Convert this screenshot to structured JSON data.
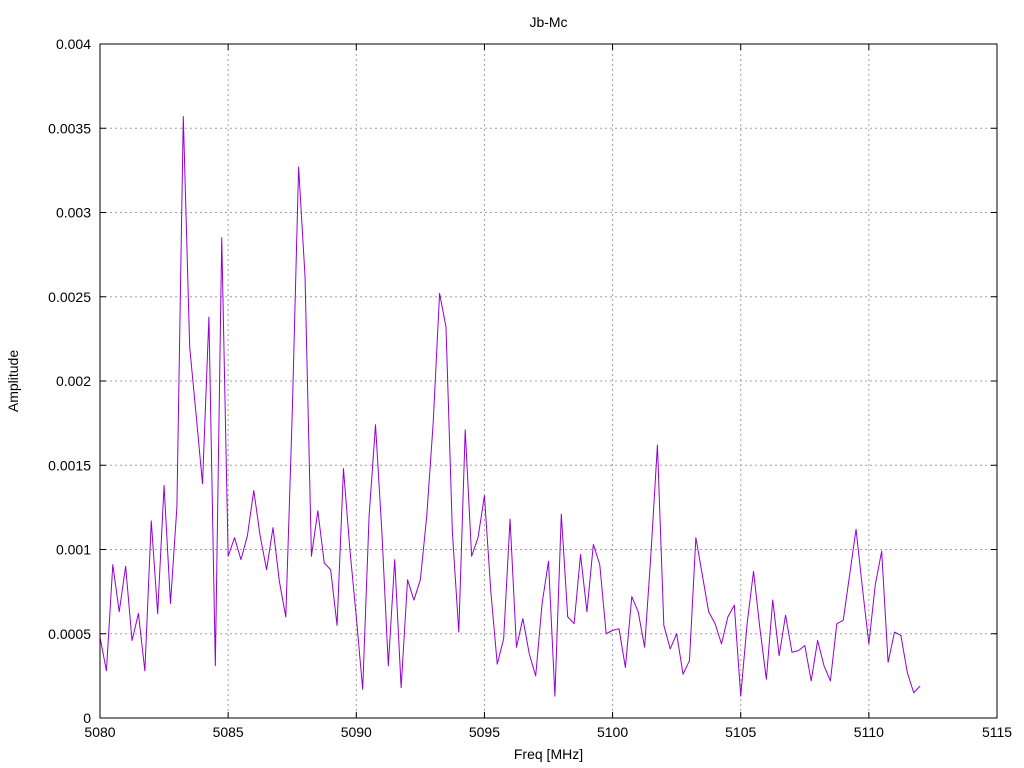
{
  "chart_data": {
    "type": "line",
    "title": "Jb-Mc",
    "xlabel": "Freq [MHz]",
    "ylabel": "Amplitude",
    "xlim": [
      5080,
      5115
    ],
    "ylim": [
      0,
      0.004
    ],
    "x_ticks": [
      "5080",
      "5085",
      "5090",
      "5095",
      "5100",
      "5105",
      "5110",
      "5115"
    ],
    "y_ticks": [
      "0",
      "0.0005",
      "0.001",
      "0.0015",
      "0.002",
      "0.0025",
      "0.003",
      "0.0035",
      "0.004"
    ],
    "grid": true,
    "legend": "none",
    "series": [
      {
        "color": "#9400d3",
        "x": [
          5080.0,
          5080.25,
          5080.5,
          5080.75,
          5081.0,
          5081.25,
          5081.5,
          5081.75,
          5082.0,
          5082.25,
          5082.5,
          5082.75,
          5083.0,
          5083.25,
          5083.5,
          5083.75,
          5084.0,
          5084.25,
          5084.5,
          5084.75,
          5085.0,
          5085.25,
          5085.5,
          5085.75,
          5086.0,
          5086.25,
          5086.5,
          5086.75,
          5087.0,
          5087.25,
          5087.5,
          5087.75,
          5088.0,
          5088.25,
          5088.5,
          5088.75,
          5089.0,
          5089.25,
          5089.5,
          5089.75,
          5090.0,
          5090.25,
          5090.5,
          5090.75,
          5091.0,
          5091.25,
          5091.5,
          5091.75,
          5092.0,
          5092.25,
          5092.5,
          5092.75,
          5093.0,
          5093.25,
          5093.5,
          5093.75,
          5094.0,
          5094.25,
          5094.5,
          5094.75,
          5095.0,
          5095.25,
          5095.5,
          5095.75,
          5096.0,
          5096.25,
          5096.5,
          5096.75,
          5097.0,
          5097.25,
          5097.5,
          5097.75,
          5098.0,
          5098.25,
          5098.5,
          5098.75,
          5099.0,
          5099.25,
          5099.5,
          5099.75,
          5100.0,
          5100.25,
          5100.5,
          5100.75,
          5101.0,
          5101.25,
          5101.5,
          5101.75,
          5102.0,
          5102.25,
          5102.5,
          5102.75,
          5103.0,
          5103.25,
          5103.5,
          5103.75,
          5104.0,
          5104.25,
          5104.5,
          5104.75,
          5105.0,
          5105.25,
          5105.5,
          5105.75,
          5106.0,
          5106.25,
          5106.5,
          5106.75,
          5107.0,
          5107.25,
          5107.5,
          5107.75,
          5108.0,
          5108.25,
          5108.5,
          5108.75,
          5109.0,
          5109.25,
          5109.5,
          5109.75,
          5110.0,
          5110.25,
          5110.5,
          5110.75,
          5111.0,
          5111.25,
          5111.5,
          5111.75,
          5112.0
        ],
        "y": [
          0.00048,
          0.00028,
          0.00091,
          0.00063,
          0.0009,
          0.00046,
          0.00062,
          0.00028,
          0.00117,
          0.00062,
          0.00138,
          0.00068,
          0.00125,
          0.00357,
          0.0022,
          0.0018,
          0.00139,
          0.00238,
          0.00031,
          0.00285,
          0.00096,
          0.00107,
          0.00094,
          0.00108,
          0.00135,
          0.00108,
          0.00088,
          0.00113,
          0.00081,
          0.0006,
          0.0018,
          0.00327,
          0.00262,
          0.00096,
          0.00123,
          0.00092,
          0.00088,
          0.00055,
          0.00148,
          0.001,
          0.0006,
          0.00017,
          0.0012,
          0.00174,
          0.0011,
          0.00031,
          0.00094,
          0.00018,
          0.00082,
          0.0007,
          0.00082,
          0.0012,
          0.00175,
          0.00252,
          0.00232,
          0.0011,
          0.00051,
          0.00171,
          0.00096,
          0.00107,
          0.00132,
          0.00075,
          0.00032,
          0.00047,
          0.00118,
          0.00042,
          0.00059,
          0.00038,
          0.00025,
          0.00068,
          0.00093,
          0.00013,
          0.00121,
          0.0006,
          0.00056,
          0.00097,
          0.00063,
          0.00103,
          0.00091,
          0.0005,
          0.00052,
          0.00053,
          0.0003,
          0.00072,
          0.00063,
          0.00042,
          0.00098,
          0.00162,
          0.00055,
          0.00041,
          0.0005,
          0.00026,
          0.00034,
          0.00107,
          0.00085,
          0.00063,
          0.00056,
          0.00044,
          0.0006,
          0.00067,
          0.00013,
          0.00056,
          0.00087,
          0.00053,
          0.00023,
          0.0007,
          0.00037,
          0.00061,
          0.00039,
          0.0004,
          0.00043,
          0.00022,
          0.00046,
          0.00031,
          0.00022,
          0.00056,
          0.00058,
          0.00085,
          0.00112,
          0.00077,
          0.00044,
          0.00079,
          0.00099,
          0.00033,
          0.00051,
          0.00049,
          0.00027,
          0.00015,
          0.00019
        ]
      }
    ]
  }
}
